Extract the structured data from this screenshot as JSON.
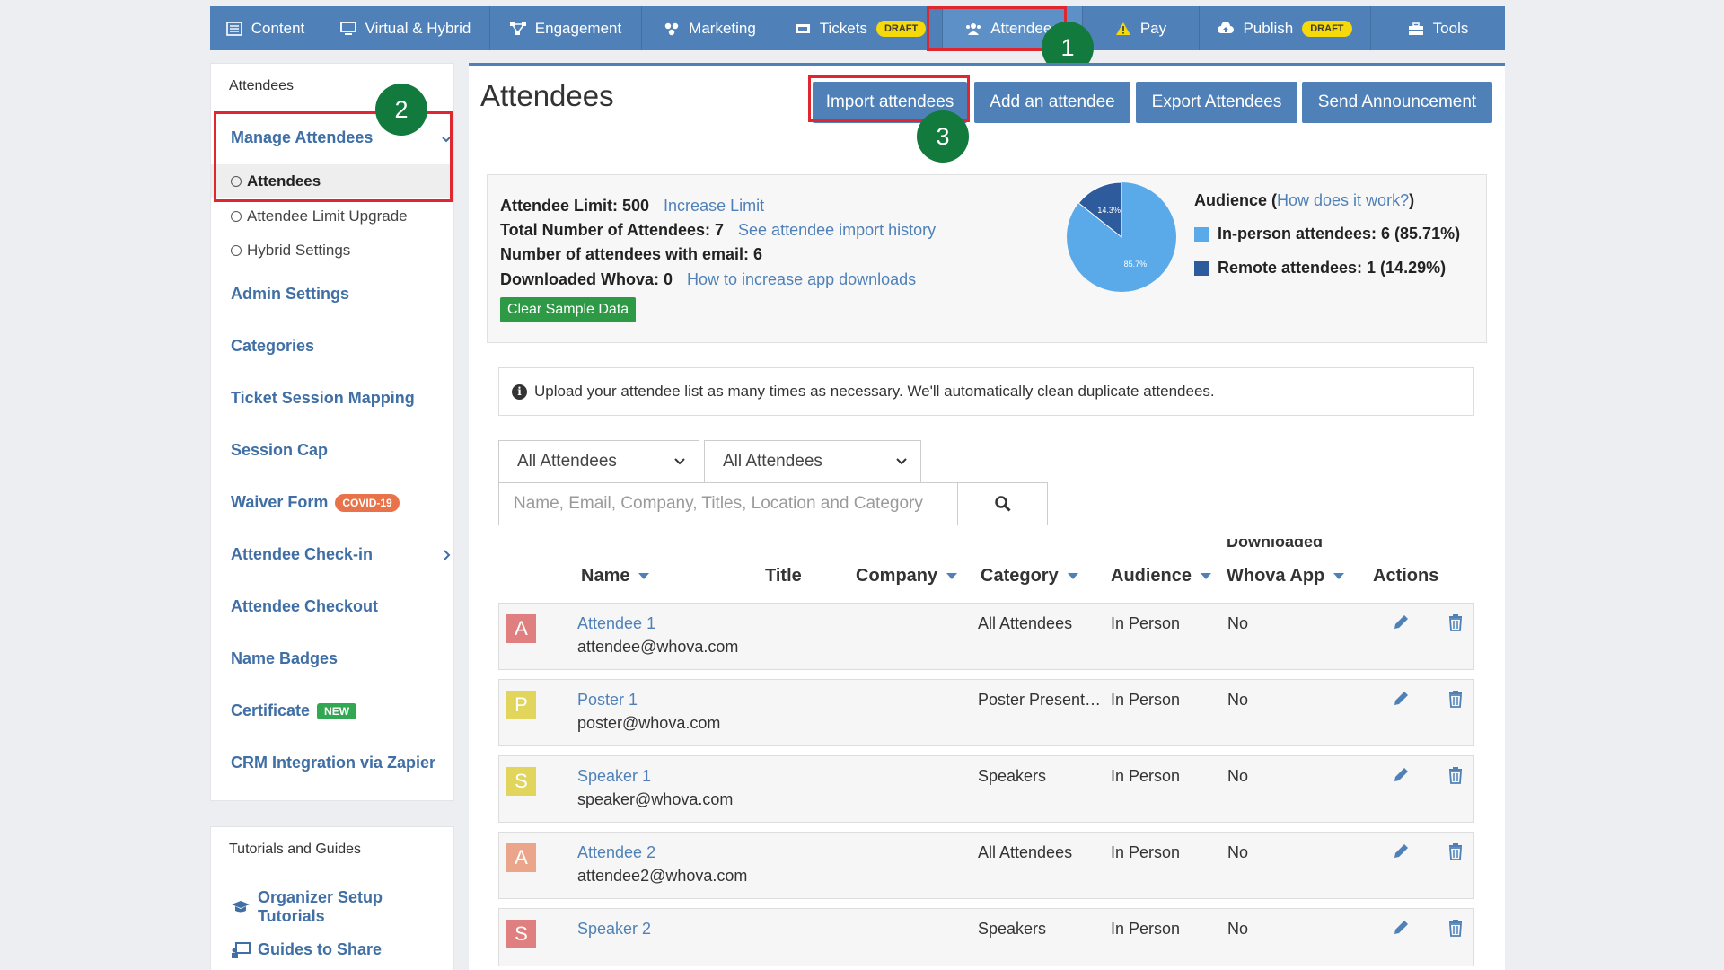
{
  "nav": {
    "items": [
      {
        "label": "Content",
        "icon": "list-icon"
      },
      {
        "label": "Virtual & Hybrid",
        "icon": "monitor-icon"
      },
      {
        "label": "Engagement",
        "icon": "network-icon"
      },
      {
        "label": "Marketing",
        "icon": "palette-icon"
      },
      {
        "label": "Tickets",
        "icon": "ticket-icon",
        "badge": "DRAFT"
      },
      {
        "label": "Attendees",
        "icon": "users-icon"
      },
      {
        "label": "Pay",
        "icon": "warning-icon"
      },
      {
        "label": "Publish",
        "icon": "cloud-upload-icon",
        "badge": "DRAFT"
      },
      {
        "label": "Tools",
        "icon": "toolbox-icon"
      }
    ]
  },
  "steps": [
    "1",
    "2",
    "3"
  ],
  "sidebar": {
    "header": "Attendees",
    "manage": "Manage Attendees",
    "subs": [
      "Attendees",
      "Attendee Limit Upgrade",
      "Hybrid Settings"
    ],
    "links": [
      "Admin Settings",
      "Categories",
      "Ticket Session Mapping",
      "Session Cap",
      "Waiver Form",
      "Attendee Check-in",
      "Attendee Checkout",
      "Name Badges",
      "Certificate",
      "CRM Integration via Zapier"
    ],
    "covid_badge": "COVID-19",
    "new_badge": "NEW",
    "tutorials_header": "Tutorials and Guides",
    "tutorial_links": [
      "Organizer Setup Tutorials",
      "Guides to Share"
    ]
  },
  "main": {
    "title": "Attendees",
    "buttons": [
      "Import attendees",
      "Add an attendee",
      "Export Attendees",
      "Send Announcement"
    ],
    "stats": {
      "limit_label": "Attendee Limit: 500",
      "limit_link": "Increase Limit",
      "total_label": "Total Number of Attendees: 7",
      "total_link": "See attendee import history",
      "email_label": "Number of attendees with email: 6",
      "downloaded_label": "Downloaded Whova: 0",
      "downloaded_link": "How to increase app downloads",
      "clear_button": "Clear Sample Data"
    },
    "audience": {
      "title": "Audience (",
      "link": "How does it work?",
      "close": ")",
      "in_person": "In-person attendees: 6 (85.71%)",
      "remote": "Remote attendees: 1 (14.29%)",
      "pie_label_small": "14.3%",
      "pie_label_large": "85.7%",
      "colors": {
        "in_person": "#5aaaea",
        "remote": "#2e5b9c"
      }
    },
    "chart_data": {
      "type": "pie",
      "categories": [
        "In-person attendees",
        "Remote attendees"
      ],
      "values": [
        85.7,
        14.3
      ]
    },
    "notice": "Upload your attendee list as many times as necessary. We'll automatically clean duplicate attendees.",
    "filter1": "All Attendees",
    "filter2": "All Attendees",
    "search_placeholder": "Name, Email, Company, Titles, Location and Category",
    "table": {
      "headers": {
        "name": "Name",
        "title": "Title",
        "company": "Company",
        "category": "Category",
        "audience": "Audience",
        "downloaded_top": "Downloaded",
        "downloaded_bottom": "Whova App",
        "actions": "Actions"
      },
      "rows": [
        {
          "initial": "A",
          "color": "#e07f7f",
          "name": "Attendee 1",
          "email": "attendee@whova.com",
          "category": "All Attendees",
          "audience": "In Person",
          "downloaded": "No"
        },
        {
          "initial": "P",
          "color": "#e2d55c",
          "name": "Poster 1",
          "email": "poster@whova.com",
          "category": "Poster Present…",
          "audience": "In Person",
          "downloaded": "No"
        },
        {
          "initial": "S",
          "color": "#e2d55c",
          "name": "Speaker 1",
          "email": "speaker@whova.com",
          "category": "Speakers",
          "audience": "In Person",
          "downloaded": "No"
        },
        {
          "initial": "A",
          "color": "#eba58a",
          "name": "Attendee 2",
          "email": "attendee2@whova.com",
          "category": "All Attendees",
          "audience": "In Person",
          "downloaded": "No"
        },
        {
          "initial": "S",
          "color": "#e07f7f",
          "name": "Speaker 2",
          "email": "",
          "category": "Speakers",
          "audience": "In Person",
          "downloaded": "No"
        }
      ]
    }
  }
}
